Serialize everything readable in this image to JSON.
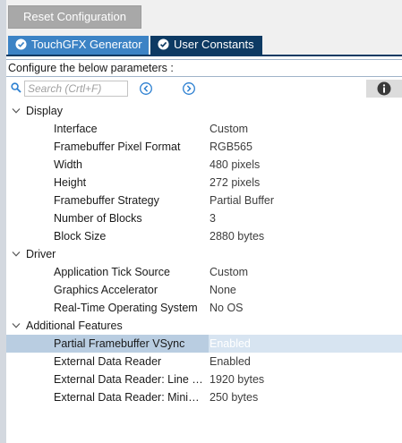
{
  "toolbar": {
    "reset_label": "Reset Configuration"
  },
  "tabs": [
    {
      "label": "TouchGFX Generator",
      "active": false
    },
    {
      "label": "User Constants",
      "active": true
    }
  ],
  "params_header": "Configure the below parameters :",
  "search": {
    "placeholder": "Search (Crtl+F)"
  },
  "groups": [
    {
      "label": "Display",
      "items": [
        {
          "name": "Interface",
          "value": "Custom"
        },
        {
          "name": "Framebuffer Pixel Format",
          "value": "RGB565"
        },
        {
          "name": "Width",
          "value": "480 pixels"
        },
        {
          "name": "Height",
          "value": "272 pixels"
        },
        {
          "name": "Framebuffer Strategy",
          "value": "Partial Buffer"
        },
        {
          "name": "Number of Blocks",
          "value": "3"
        },
        {
          "name": "Block Size",
          "value": "2880 bytes"
        }
      ]
    },
    {
      "label": "Driver",
      "items": [
        {
          "name": "Application Tick Source",
          "value": "Custom"
        },
        {
          "name": "Graphics Accelerator",
          "value": "None"
        },
        {
          "name": "Real-Time Operating System",
          "value": "No OS"
        }
      ]
    },
    {
      "label": "Additional Features",
      "items": [
        {
          "name": "Partial Framebuffer VSync",
          "value": "Enabled",
          "selected": true
        },
        {
          "name": "External Data Reader",
          "value": "Enabled"
        },
        {
          "name": "External Data Reader: Line B...",
          "value": "1920 bytes"
        },
        {
          "name": "External Data Reader: Minimu...",
          "value": "250 bytes"
        }
      ]
    }
  ],
  "colors": {
    "tab_inactive": "#3c83c5",
    "tab_active": "#0d3a63",
    "selection": "#b9cde1",
    "nav_icon": "#2b7fd1"
  },
  "icons": {
    "search": "search-icon",
    "prev": "circle-chevron-left-icon",
    "next": "circle-chevron-right-icon",
    "info": "info-icon",
    "tab": "check-circle-icon",
    "group": "chevron-down-icon"
  }
}
